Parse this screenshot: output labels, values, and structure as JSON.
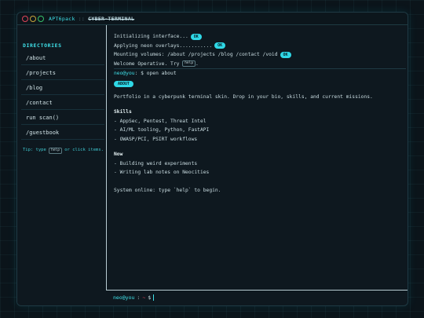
{
  "window": {
    "brand": "APT6pack",
    "separator": "::",
    "subtitle": "CYBER-TERMINAL"
  },
  "sidebar": {
    "heading": "DIRECTORIES",
    "items": [
      {
        "label": "/about"
      },
      {
        "label": "/projects"
      },
      {
        "label": "/blog"
      },
      {
        "label": "/contact"
      },
      {
        "label": "run scan()"
      },
      {
        "label": "/guestbook"
      }
    ],
    "tip_prefix": "Tip: type",
    "tip_key": "help",
    "tip_suffix": "or click items."
  },
  "terminal": {
    "boot": [
      {
        "text": "Initializing interface...",
        "badge": "OK"
      },
      {
        "text": "Applying neon overlays...........",
        "badge": "OK"
      },
      {
        "text": "Mounting volumes: /about /projects /blog /contact /void",
        "badge": "OK"
      }
    ],
    "welcome_prefix": "Welcome Operative. Try",
    "welcome_key": "help",
    "welcome_suffix": ".",
    "prompt_user": "neo@you",
    "prompt_cmd": ": $ open about",
    "about_badge": "ABOUT",
    "intro": "Portfolio in a cyberpunk terminal skin. Drop in your bio, skills, and current missions.",
    "skills_head": "Skills",
    "skills": [
      "- AppSec, Pentest, Threat Intel",
      "- AI/ML tooling, Python, FastAPI",
      "- OWASP/PCI, PSIRT workflows"
    ],
    "now_head": "Now",
    "now": [
      "- Building weird experiments",
      "- Writing lab notes on Neocities"
    ],
    "status": "System online: type `help` to begin."
  },
  "input": {
    "user": "neo@you",
    "colon": ":",
    "tilde": "~",
    "dollar": "$"
  },
  "colors": {
    "accent": "#3fe0e8",
    "background": "#0e181f",
    "dot_red": "#e0445a",
    "dot_yellow": "#c7a53a",
    "dot_green": "#36c06a"
  }
}
